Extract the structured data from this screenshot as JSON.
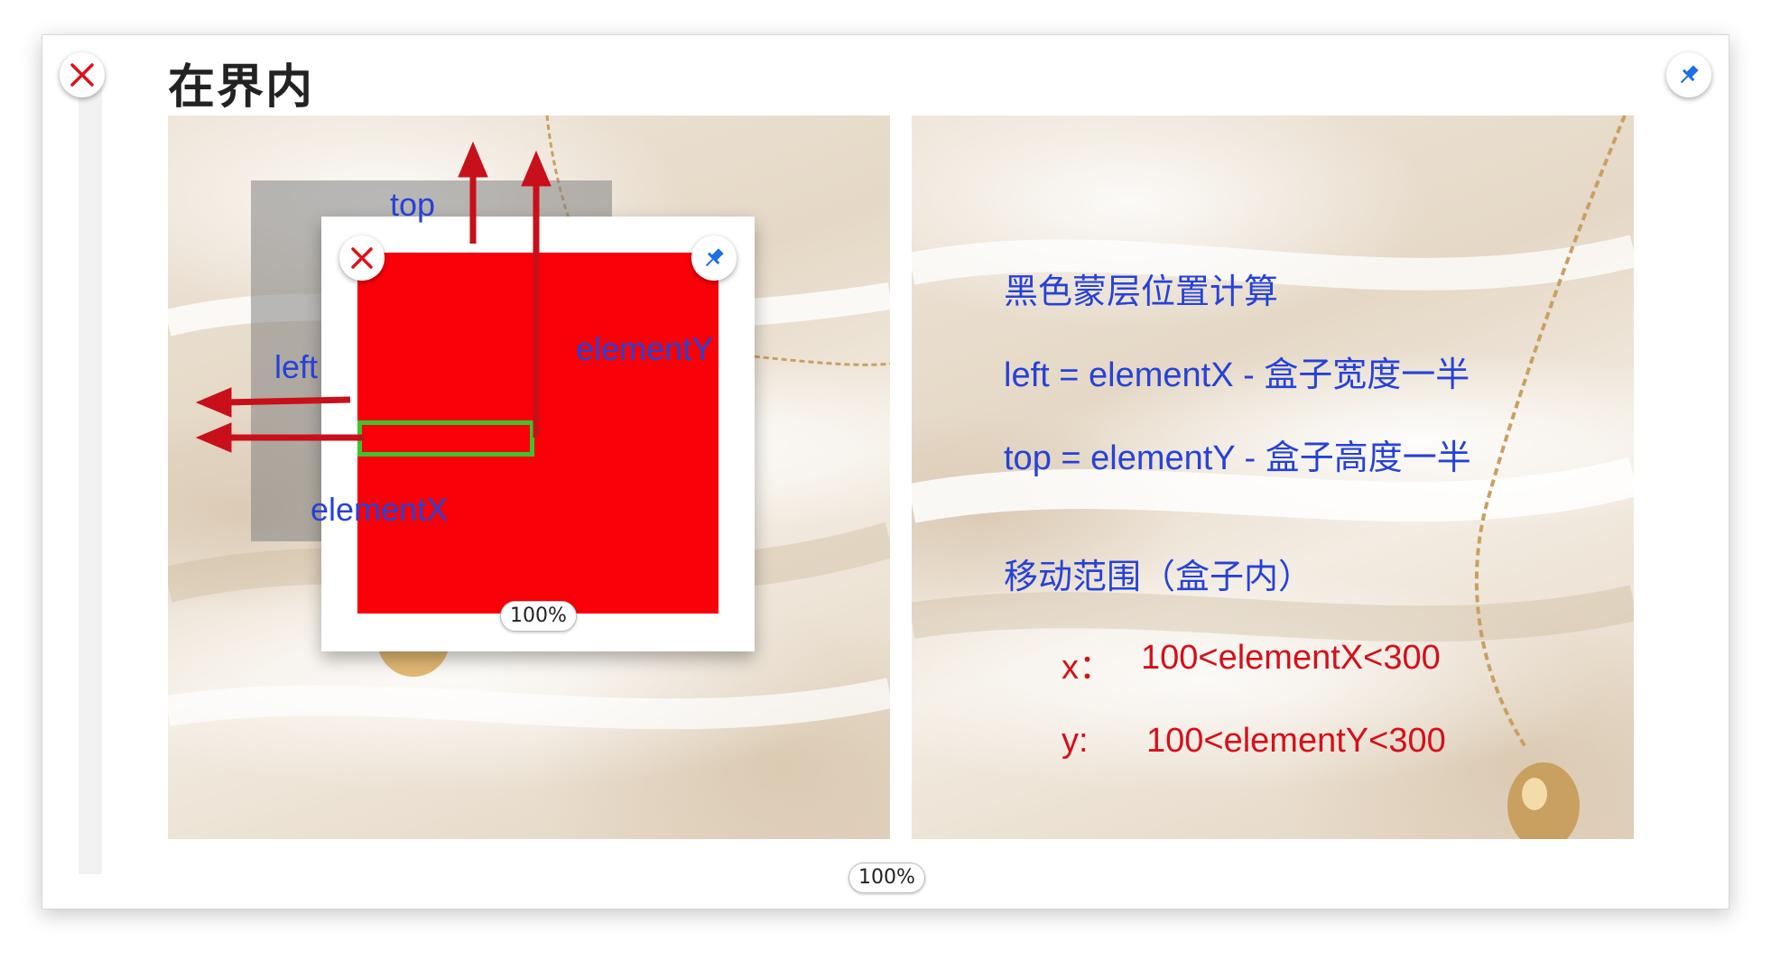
{
  "slide": {
    "title": "在界内",
    "zoom_outer": "100%",
    "zoom_inner": "100%"
  },
  "diagram": {
    "label_top": "top",
    "label_left": "left",
    "label_elementX": "elementX",
    "label_elementY": "elementY"
  },
  "info": {
    "heading": "黑色蒙层位置计算",
    "left_formula": "left = elementX - 盒子宽度一半",
    "top_formula": "top = elementY  - 盒子高度一半",
    "range_heading": "移动范围（盒子内）",
    "x_label": "x：",
    "x_range": "100<elementX<300",
    "y_label": "y:",
    "y_range": "100<elementY<300"
  },
  "colors": {
    "close": "#e0101a",
    "pin": "#1c6fe6",
    "label_blue": "#2642d6",
    "range_red": "#d4101a",
    "box_red": "#fa0009",
    "green": "#3ec22e"
  },
  "icons": {
    "close": "close-x-icon",
    "pin": "pin-icon"
  }
}
